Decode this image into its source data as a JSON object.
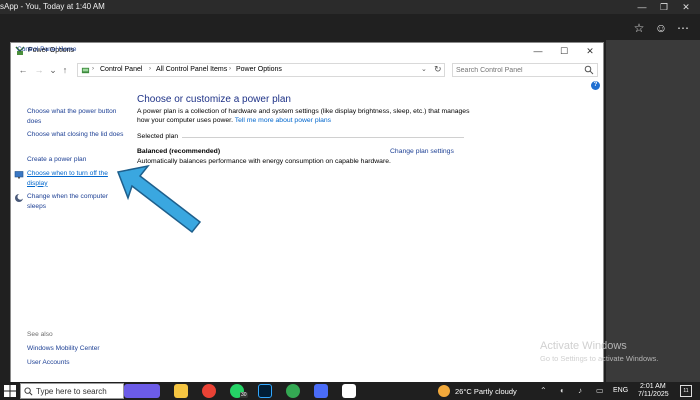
{
  "viewer": {
    "title": "sApp - You, Today at 1:40 AM",
    "minimize": "—",
    "restore": "❐",
    "close": "✕",
    "star": "☆",
    "emoji": "☺",
    "more": "⋯"
  },
  "window": {
    "title": "Power Options",
    "min": "—",
    "max": "☐",
    "close": "✕"
  },
  "nav": {
    "back": "←",
    "forward": "→",
    "recent": "⌄",
    "up": "↑",
    "breadcrumb": [
      "Control Panel",
      "All Control Panel Items",
      "Power Options"
    ],
    "search_placeholder": "Search Control Panel"
  },
  "sidebar": {
    "home": "Control Panel Home",
    "items": [
      "Choose what the power button does",
      "Choose what closing the lid does",
      "Create a power plan",
      "Choose when to turn off the display",
      "Change when the computer sleeps"
    ],
    "see_also": "See also",
    "see_also_items": [
      "Windows Mobility Center",
      "User Accounts"
    ]
  },
  "main": {
    "heading": "Choose or customize a power plan",
    "description": "A power plan is a collection of hardware and system settings (like display brightness, sleep, etc.) that manages how your computer uses power.",
    "learn_more": "Tell me more about power plans",
    "selected_plan": "Selected plan",
    "plan_name": "Balanced (recommended)",
    "plan_desc": "Automatically balances performance with energy consumption on capable hardware.",
    "plan_settings": "Change plan settings"
  },
  "watermark": {
    "title": "Activate Windows",
    "subtitle": "Go to Settings to activate Windows."
  },
  "taskbar": {
    "search_placeholder": "Type here to search",
    "badge_whatsapp": "30",
    "weather": "26°C  Partly cloudy",
    "language": "ENG",
    "time": "2:01 AM",
    "date": "7/11/2025",
    "notifications": "11",
    "colors": {
      "app1": "#6c5ce7",
      "app2": "#f5c542",
      "chrome": "#e94235",
      "whatsapp": "#25d366",
      "photoshop": "#001e36",
      "app6": "#4a6cf7",
      "chrome2": "#34a853",
      "app8": "#ffffff"
    }
  }
}
